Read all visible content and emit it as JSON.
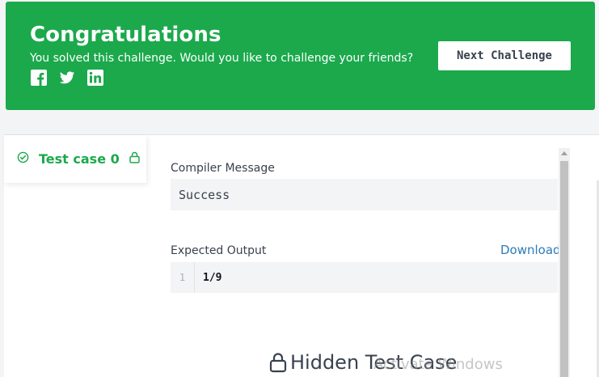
{
  "banner": {
    "title": "Congratulations",
    "subtitle": "You solved this challenge. Would you like to challenge your friends?",
    "next_button": "Next Challenge",
    "background_color": "#1ba94c",
    "social_icons": [
      "facebook-icon",
      "twitter-icon",
      "linkedin-icon"
    ]
  },
  "test_tab": {
    "label": "Test case 0",
    "status_icon": "check-circle-icon",
    "lock_icon": "lock-icon"
  },
  "compiler": {
    "label": "Compiler Message",
    "message": "Success"
  },
  "expected_output": {
    "label": "Expected Output",
    "download_label": "Download",
    "lines": [
      {
        "number": "1",
        "text": "1/9"
      }
    ]
  },
  "hidden_test_case": {
    "label": "Hidden Test Case",
    "icon": "lock-icon"
  },
  "watermark": "Activate Windows"
}
